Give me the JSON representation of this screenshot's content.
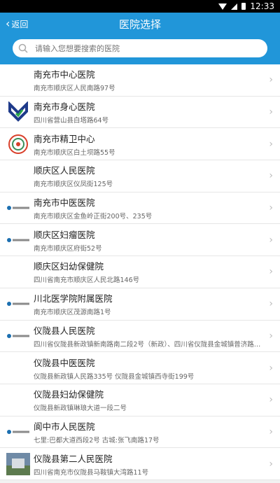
{
  "status_bar": {
    "time": "12:33"
  },
  "header": {
    "back_label": "返回",
    "title": "医院选择"
  },
  "search": {
    "placeholder": "请输入您想要搜索的医院"
  },
  "hospitals": [
    {
      "name": "南充市中心医院",
      "address": "南充市顺庆区人民南路97号",
      "logo": "none"
    },
    {
      "name": "南充市身心医院",
      "address": "四川省营山县白塔路64号",
      "logo": "heart-logo-icon"
    },
    {
      "name": "南充市精卫中心",
      "address": "南充市顺庆区白土坝路55号",
      "logo": "emblem-logo-icon"
    },
    {
      "name": "顺庆区人民医院",
      "address": "南充市顺庆区仪凤街125号",
      "logo": "none"
    },
    {
      "name": "南充市中医医院",
      "address": "南充市顺庆区金鱼岭正街200号、235号",
      "logo": "text-logo-icon"
    },
    {
      "name": "顺庆区妇瘤医院",
      "address": "南充市顺庆区府街52号",
      "logo": "text-logo-icon"
    },
    {
      "name": "顺庆区妇幼保健院",
      "address": "四川省南充市顺庆区人民北路146号",
      "logo": "none"
    },
    {
      "name": "川北医学院附属医院",
      "address": "南充市顺庆区茂源南路1号",
      "logo": "text-logo-icon"
    },
    {
      "name": "仪陇县人民医院",
      "address": "四川省仪陇县新政镇新南路南二段2号（新政）、四川省仪陇县金城镇普济路13...",
      "logo": "text-logo-icon"
    },
    {
      "name": "仪陇县中医医院",
      "address": "仪陇县新政镇人民路335号 仪陇县金城镇西寺街199号",
      "logo": "none"
    },
    {
      "name": "仪陇县妇幼保健院",
      "address": "仪陇县新政镇琳琅大道一段二号",
      "logo": "none"
    },
    {
      "name": "阆中市人民医院",
      "address": "七里:巴都大道西段2号  古城:张飞南路17号",
      "logo": "text-logo-icon"
    },
    {
      "name": "仪陇县第二人民医院",
      "address": "四川省南充市仪陇县马鞍镇大湾路11号",
      "logo": "photo-logo-icon"
    }
  ],
  "colors": {
    "header_bg": "#2196d9",
    "heart_logo": "#1e3a8a",
    "heart_logo_accent": "#2aa84a",
    "emblem_logo": "#d9402b"
  }
}
